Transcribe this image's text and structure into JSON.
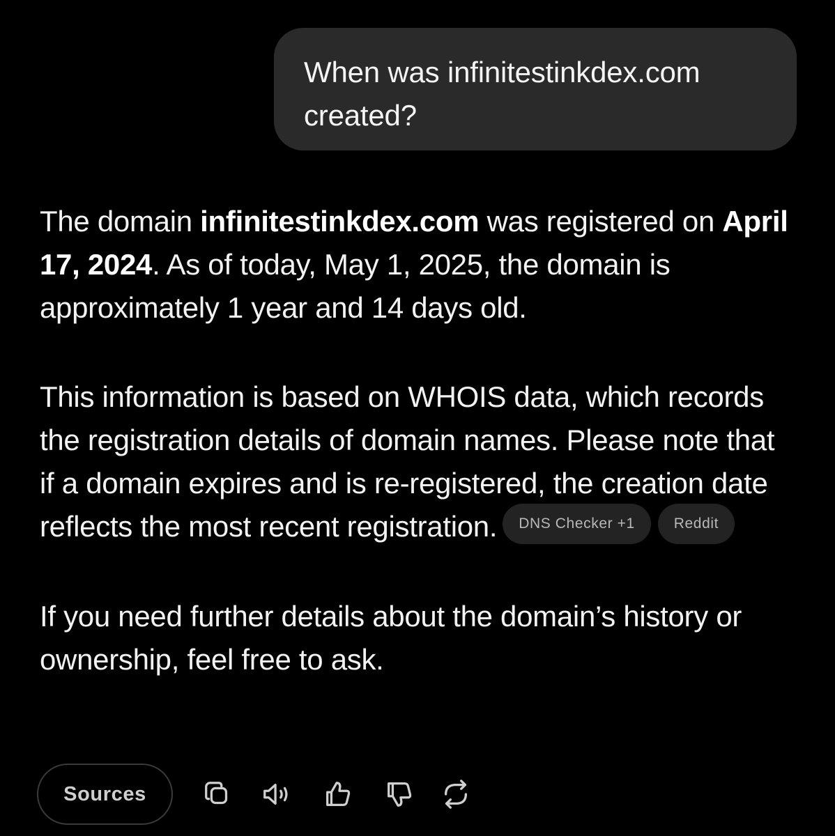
{
  "user_message": {
    "text": "When was infinitestinkdex.com created?"
  },
  "response": {
    "para1": {
      "t1": "The domain ",
      "b1": "infinitestinkdex.com",
      "t2": " was registered on ",
      "b2": "April 17, 2024",
      "t3": ". As of today, May 1, 2025, the domain is approximately 1 year and 14 days old."
    },
    "para2": {
      "text": "This information is based on WHOIS data, which records the registration details of domain names. Please note that if a domain expires and is re-registered, the creation date reflects the most recent registration."
    },
    "citations": [
      {
        "label": "DNS Checker +1"
      },
      {
        "label": "Reddit"
      }
    ],
    "para3": {
      "text": "If you need further details about the domain’s history or ownership, feel free to ask."
    }
  },
  "actions": {
    "sources_label": "Sources",
    "icons": [
      "copy-icon",
      "read-aloud-icon",
      "thumbs-up-icon",
      "thumbs-down-icon",
      "regenerate-icon"
    ]
  },
  "colors": {
    "background": "#000000",
    "bubble": "#2a2a2a",
    "chip": "#232323",
    "text": "#f2f2f2",
    "muted": "#cfcfcf"
  }
}
